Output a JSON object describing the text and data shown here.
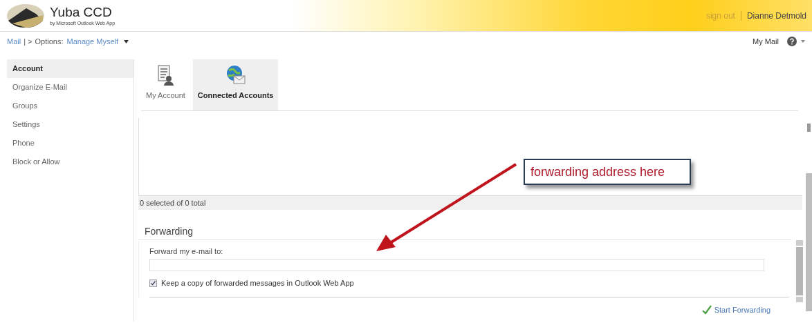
{
  "header": {
    "title": "Yuba CCD",
    "subtitle": "by Microsoft Outlook Web App",
    "sign_out": "sign out",
    "user": "Dianne Detmold"
  },
  "breadcrumb": {
    "mail": "Mail",
    "separator": "| >",
    "options": "Options:",
    "section": "Manage Myself"
  },
  "toolbar": {
    "my_mail": "My Mail"
  },
  "sidebar": {
    "items": [
      {
        "label": "Account",
        "selected": true
      },
      {
        "label": "Organize E-Mail",
        "selected": false
      },
      {
        "label": "Groups",
        "selected": false
      },
      {
        "label": "Settings",
        "selected": false
      },
      {
        "label": "Phone",
        "selected": false
      },
      {
        "label": "Block or Allow",
        "selected": false
      }
    ]
  },
  "tabs": [
    {
      "label": "My Account",
      "kind": "account",
      "selected": false
    },
    {
      "label": "Connected Accounts",
      "kind": "globe",
      "selected": true
    }
  ],
  "list": {
    "status": "0 selected of 0 total"
  },
  "forwarding": {
    "heading": "Forwarding",
    "field_label": "Forward my e-mail to:",
    "keep_copy": {
      "label": "Keep a copy of forwarded messages in Outlook Web App",
      "checked": true
    },
    "action": "Start Forwarding"
  },
  "callout": {
    "text": "forwarding address here"
  }
}
